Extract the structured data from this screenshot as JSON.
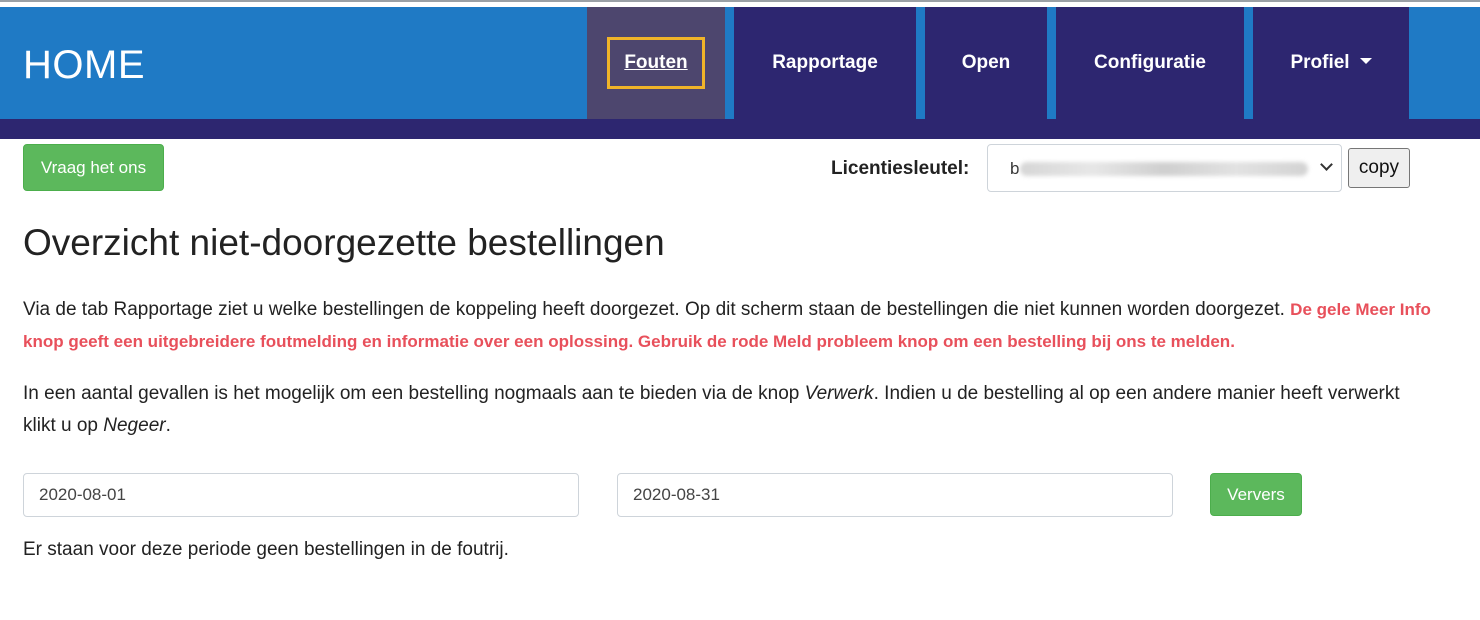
{
  "header": {
    "brand": "HOME",
    "nav": [
      {
        "label": "Fouten",
        "active": true
      },
      {
        "label": "Rapportage"
      },
      {
        "label": "Open"
      },
      {
        "label": "Configuratie"
      },
      {
        "label": "Profiel",
        "dropdown": true
      }
    ]
  },
  "toolbar": {
    "ask_button": "Vraag het ons",
    "license_label": "Licentiesleutel:",
    "license_value_visible": "b",
    "copy_button": "copy"
  },
  "main": {
    "title": "Overzicht niet-doorgezette bestellingen",
    "intro": "Via de tab Rapportage ziet u welke bestellingen de koppeling heeft doorgezet. Op dit scherm staan de bestellingen die niet kunnen worden doorgezet.",
    "intro_warning": "De gele Meer Info knop geeft een uitgebreidere foutmelding en informatie over een oplossing. Gebruik de rode Meld probleem knop om een bestelling bij ons te melden.",
    "para2_a": "In een aantal gevallen is het mogelijk om een bestelling nogmaals aan te bieden via de knop ",
    "para2_verwerk": "Verwerk",
    "para2_b": ". Indien u de bestelling al op een andere manier heeft verwerkt klikt u op ",
    "para2_negeer": "Negeer",
    "para2_c": ".",
    "date_from": "2020-08-01",
    "date_to": "2020-08-31",
    "refresh_button": "Ververs",
    "empty_message": "Er staan voor deze periode geen bestellingen in de foutrij."
  },
  "colors": {
    "header_blue": "#1f7ac5",
    "nav_purple": "#2d2670",
    "active_nav": "#4d466e",
    "focus_outline": "#f0b429",
    "success_green": "#5cb85c",
    "warning_red": "#e8505b"
  }
}
